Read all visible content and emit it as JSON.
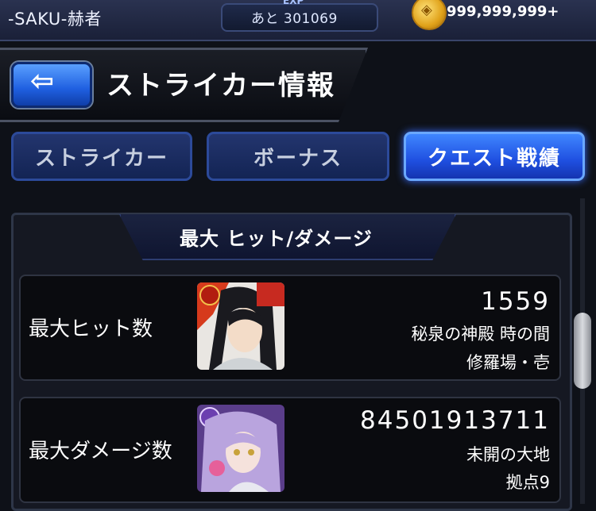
{
  "header": {
    "player_name": "-SAKU-赫者",
    "exp_label": "EXP",
    "exp_text": "あと 301069",
    "coins": "999,999,999+",
    "title": "ストライカー情報",
    "back_icon": "back-arrow-icon"
  },
  "tabs": [
    {
      "label": "ストライカー",
      "active": false
    },
    {
      "label": "ボーナス",
      "active": false
    },
    {
      "label": "クエスト戦績",
      "active": true
    }
  ],
  "section": {
    "title": "最大 ヒット/ダメージ",
    "rows": [
      {
        "label": "最大ヒット数",
        "value": "1559",
        "quest": "秘泉の神殿 時の間",
        "stage": "修羅場・壱"
      },
      {
        "label": "最大ダメージ数",
        "value": "84501913711",
        "quest": "未開の大地",
        "stage": "拠点9"
      }
    ]
  },
  "colors": {
    "accent_blue": "#1f4fe0",
    "gold": "#e0a21a",
    "background": "#0e1118"
  }
}
